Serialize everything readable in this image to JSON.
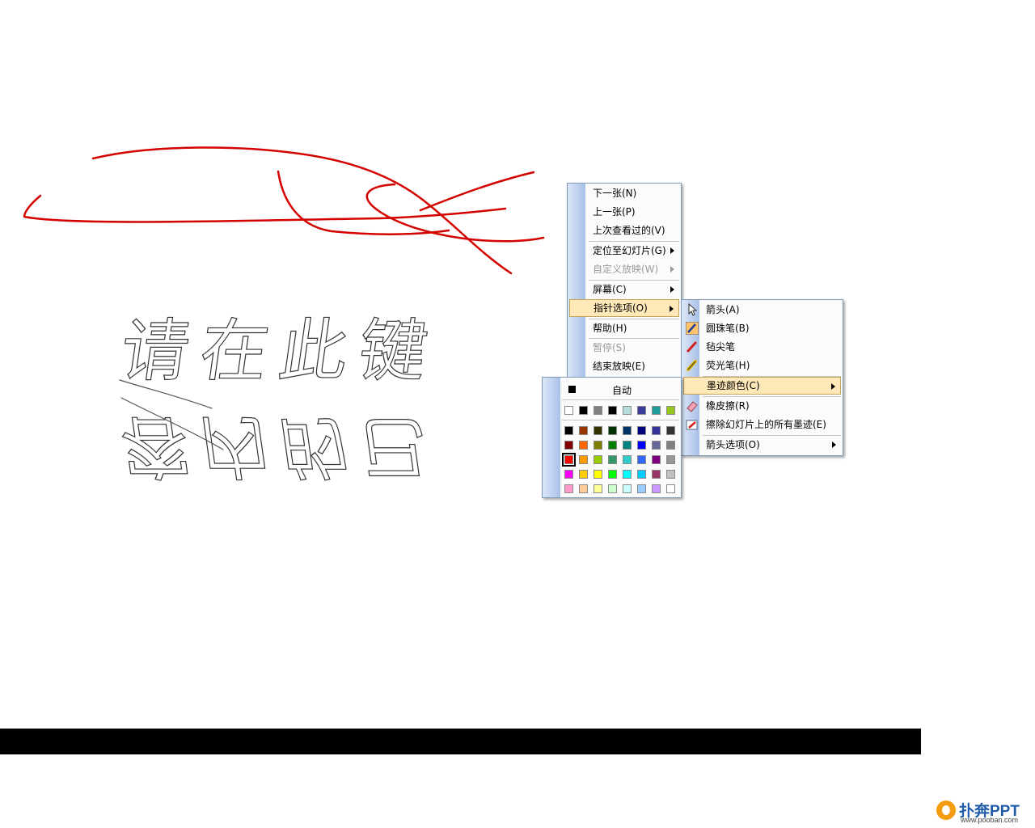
{
  "slide": {
    "title_line_1": "请在此键",
    "title_line_2": "容内的已",
    "ink_color": "#d40000",
    "bar_color": "#000000"
  },
  "logo": {
    "name": "扑奔PPT",
    "url": "www.pooban.com"
  },
  "context_menu": {
    "items": [
      {
        "label": "下一张(N)",
        "enabled": true
      },
      {
        "label": "上一张(P)",
        "enabled": true
      },
      {
        "label": "上次查看过的(V)",
        "enabled": true
      },
      {
        "label": "定位至幻灯片(G)",
        "enabled": true,
        "submenu": true
      },
      {
        "label": "自定义放映(W)",
        "enabled": false,
        "submenu": true
      },
      {
        "label": "屏幕(C)",
        "enabled": true,
        "submenu": true
      },
      {
        "label": "指针选项(O)",
        "enabled": true,
        "submenu": true,
        "highlighted": true
      },
      {
        "label": "帮助(H)",
        "enabled": true
      },
      {
        "label": "暂停(S)",
        "enabled": false
      },
      {
        "label": "结束放映(E)",
        "enabled": true
      }
    ]
  },
  "pointer_menu": {
    "items": [
      {
        "label": "箭头(A)",
        "icon": "arrow-cursor-icon"
      },
      {
        "label": "圆珠笔(B)",
        "icon": "ballpoint-pen-icon",
        "checked": true
      },
      {
        "label": "毡尖笔",
        "icon": "felt-tip-pen-icon"
      },
      {
        "label": "荧光笔(H)",
        "icon": "highlighter-icon"
      },
      {
        "label": "墨迹颜色(C)",
        "submenu": true,
        "highlighted": true
      },
      {
        "label": "橡皮擦(R)",
        "icon": "eraser-icon"
      },
      {
        "label": "擦除幻灯片上的所有墨迹(E)",
        "icon": "erase-all-ink-icon"
      },
      {
        "label": "箭头选项(O)",
        "submenu": true
      }
    ]
  },
  "ink_colors": {
    "auto_label": "自动",
    "auto_color": "#000000",
    "selected": "#ff0000",
    "theme_row": [
      "#ffffff",
      "#000000",
      "#808080",
      "#000000",
      "#b4dcdc",
      "#3c3c9c",
      "#1e9c9c",
      "#96c81e"
    ],
    "standard_rows": [
      [
        "#000000",
        "#993300",
        "#333300",
        "#003300",
        "#003366",
        "#000080",
        "#333399",
        "#333333"
      ],
      [
        "#800000",
        "#ff6600",
        "#808000",
        "#008000",
        "#008080",
        "#0000ff",
        "#666699",
        "#808080"
      ],
      [
        "#ff0000",
        "#ff9900",
        "#99cc00",
        "#339966",
        "#33cccc",
        "#3366ff",
        "#800080",
        "#969696"
      ],
      [
        "#ff00ff",
        "#ffcc00",
        "#ffff00",
        "#00ff00",
        "#00ffff",
        "#00ccff",
        "#993366",
        "#c0c0c0"
      ],
      [
        "#ff99cc",
        "#ffcc99",
        "#ffff99",
        "#ccffcc",
        "#ccffff",
        "#99ccff",
        "#cc99ff",
        "#ffffff"
      ]
    ]
  }
}
